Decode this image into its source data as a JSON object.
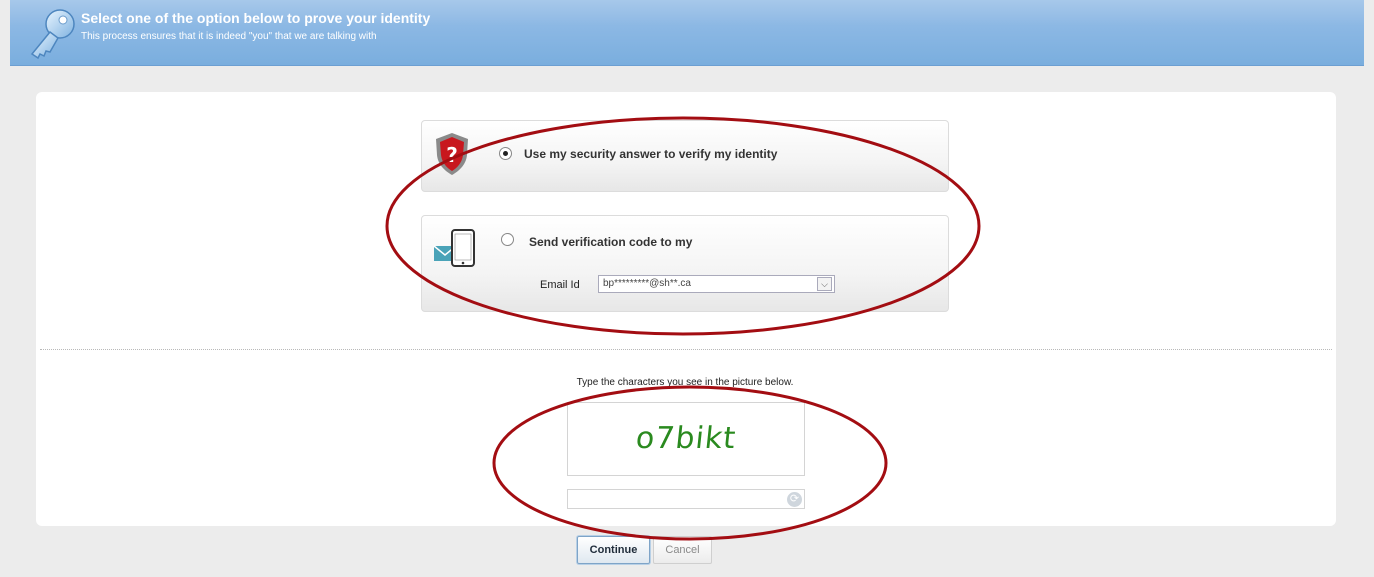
{
  "header": {
    "title": "Select one of the option below to prove your identity",
    "subtitle": "This process ensures that it is indeed \"you\" that we are talking with",
    "icon": "key-icon"
  },
  "options": [
    {
      "label": "Use my security answer to verify my identity",
      "icon": "shield-question-icon",
      "selected": true
    },
    {
      "label": "Send verification code to my",
      "icon": "email-phone-icon",
      "selected": false,
      "email_label": "Email Id",
      "email_value": "bp*********@sh**.ca"
    }
  ],
  "captcha": {
    "prompt": "Type the characters you see in the picture below.",
    "image_text": "o7bikt",
    "input_value": "",
    "refresh_icon": "refresh-icon"
  },
  "buttons": {
    "continue": "Continue",
    "cancel": "Cancel"
  },
  "colors": {
    "header_blue": "#8cb8e4",
    "annotation_red": "#a30d12",
    "captcha_green": "#2a8a1f"
  }
}
